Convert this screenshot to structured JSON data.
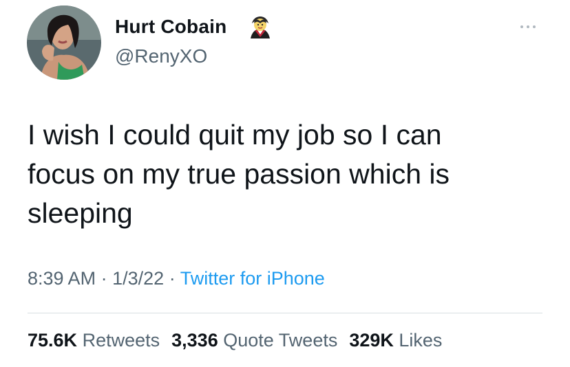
{
  "author": {
    "display_name": "Hurt Cobain",
    "handle": "@RenyXO",
    "avatar_icon": "profile-photo",
    "name_emoji_icon": "vampire-emoji"
  },
  "tweet": {
    "text_lines": [
      "I wish I could quit my job so I can",
      "focus on my true passion which is",
      "sleeping"
    ],
    "time": "8:39 AM",
    "separator": "·",
    "date": "1/3/22",
    "source": "Twitter for iPhone"
  },
  "stats": {
    "retweets_count": "75.6K",
    "retweets_label": "Retweets",
    "quotes_count": "3,336",
    "quotes_label": "Quote Tweets",
    "likes_count": "329K",
    "likes_label": "Likes"
  },
  "more_icon": "ellipsis-icon",
  "colors": {
    "text": "#0f1419",
    "secondary": "#536471",
    "link": "#1d9bf0",
    "divider": "#d7dde1"
  }
}
